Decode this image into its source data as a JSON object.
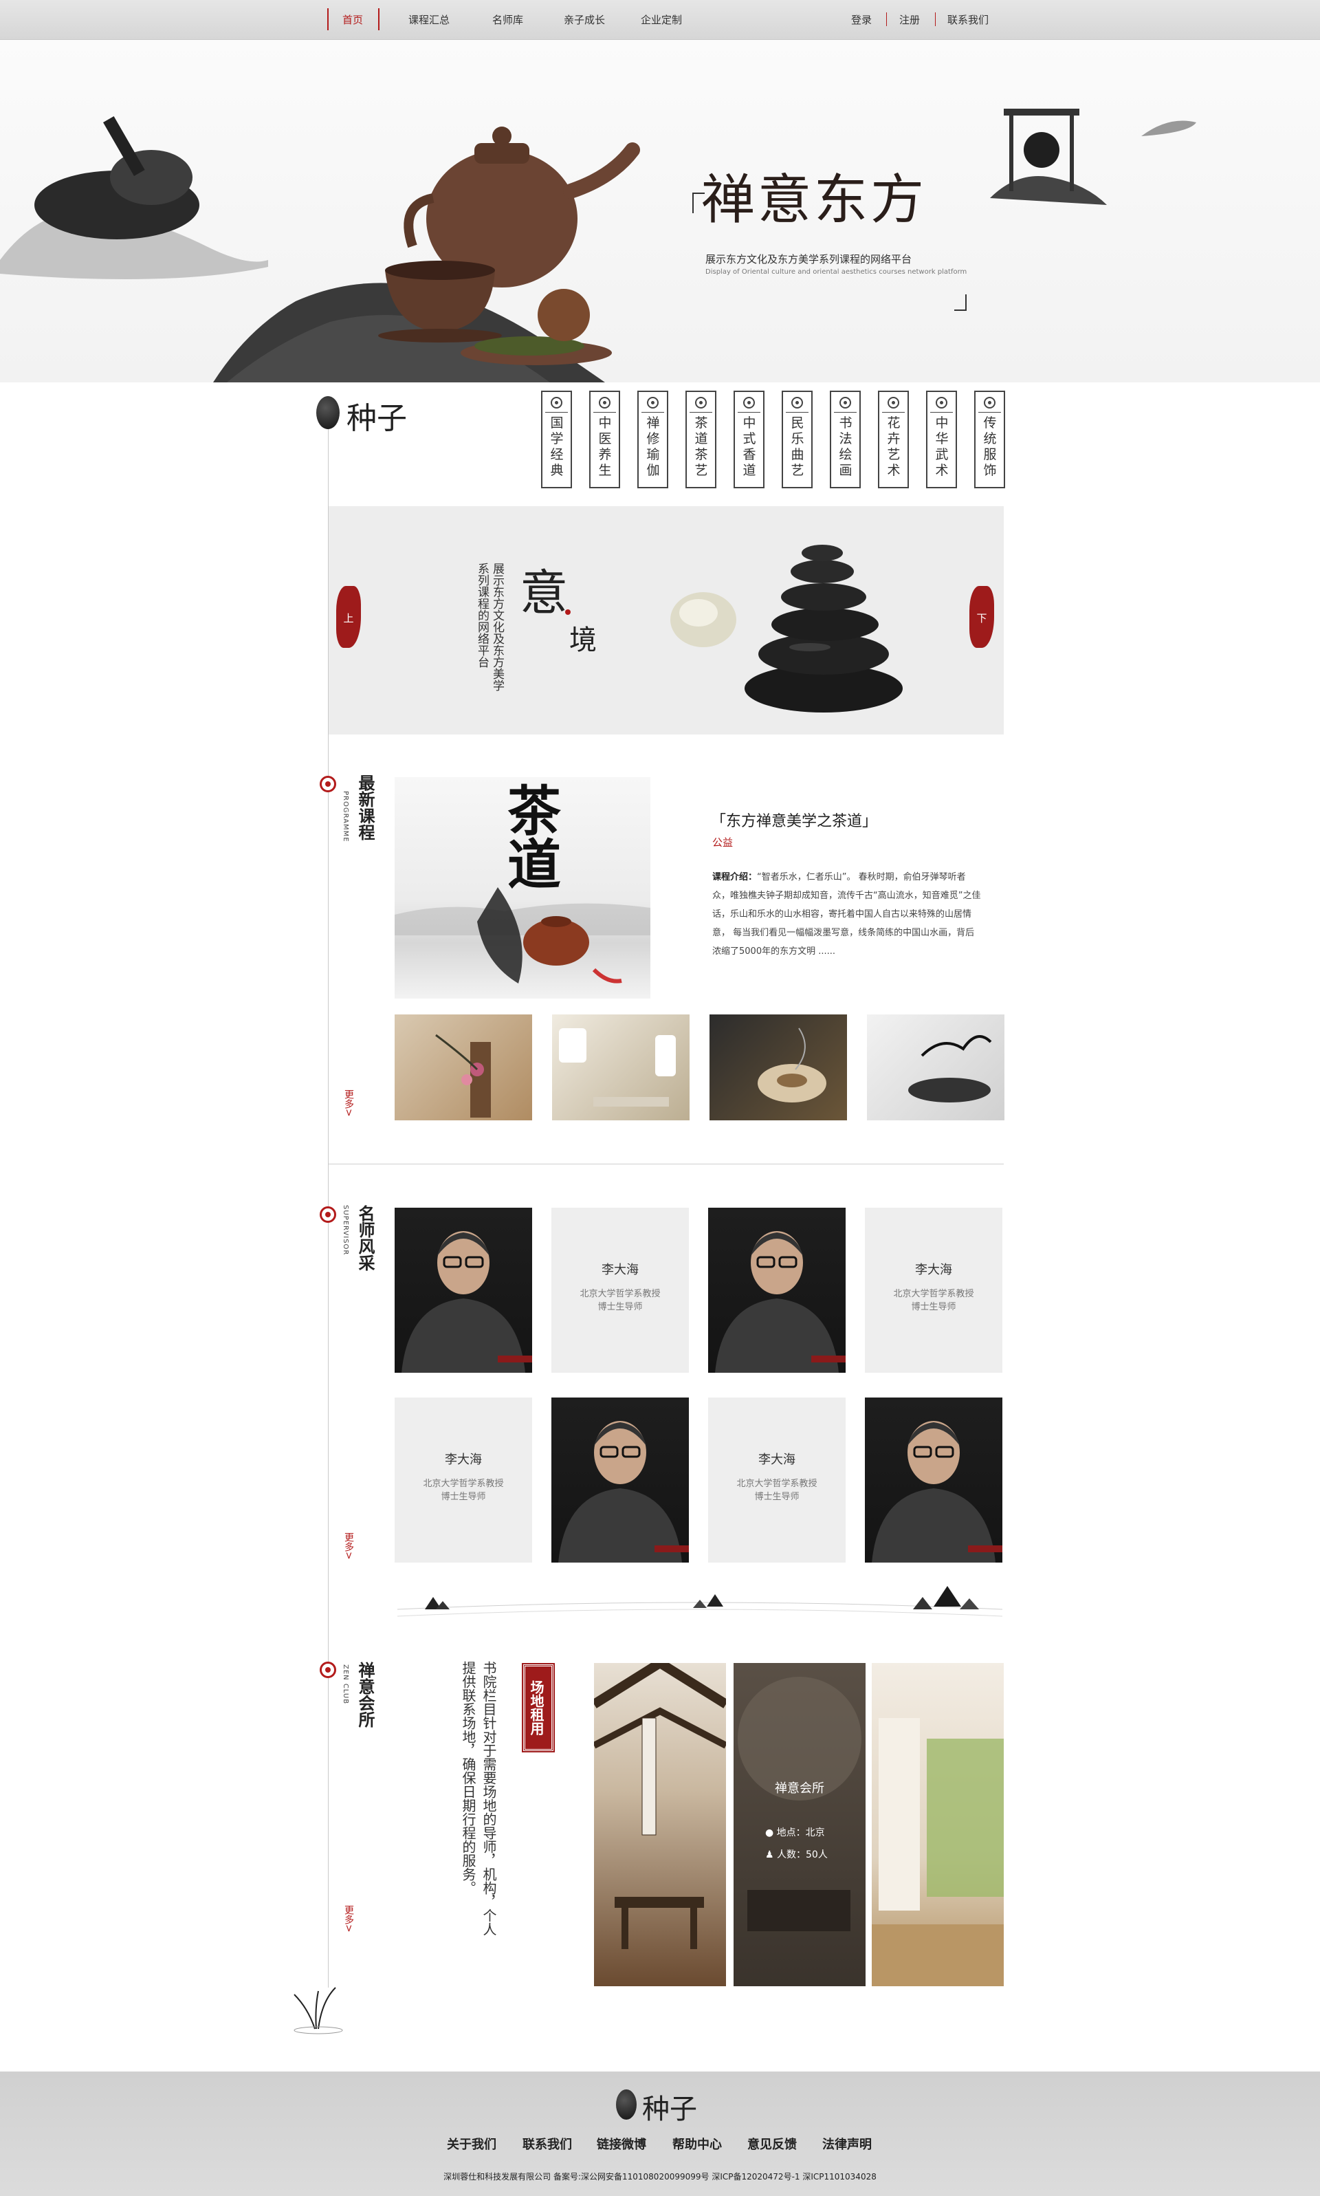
{
  "nav": {
    "items": [
      "首页",
      "课程汇总",
      "名师库",
      "亲子成长",
      "企业定制"
    ],
    "right": [
      "登录",
      "注册",
      "联系我们"
    ]
  },
  "banner": {
    "title": "禅意东方",
    "subtitle": "展示东方文化及东方美学系列课程的网络平台",
    "subtitle_en": "Display of Oriental culture and oriental aesthetics courses network platform"
  },
  "brand": {
    "name": "种子"
  },
  "categories": [
    "国学经典",
    "中医养生",
    "禅修瑜伽",
    "茶道茶艺",
    "中式香道",
    "民乐曲艺",
    "书法绘画",
    "花卉艺术",
    "中华武术",
    "传统服饰"
  ],
  "yijing": {
    "text": "展示东方文化及东方美学系列课程的网络平台",
    "yi": "意",
    "jing": "境",
    "prev": "上",
    "next": "下"
  },
  "courses": {
    "title": "最新课程",
    "title_en": "PROGRAMME",
    "featured_title": "东方禅意美学之茶道",
    "featured_tag": "公益",
    "desc_label": "课程介绍：",
    "desc": "“智者乐水，仁者乐山”。 春秋时期，俞伯牙弹琴听者众，唯独樵夫钟子期却成知音，流传千古“高山流水，知音难觅”之佳话，乐山和乐水的山水相容，寄托着中国人自古以来特殊的山居情意， 每当我们看见一幅幅泼墨写意，线条简练的中国山水画，背后浓缩了5000年的东方文明 ......",
    "image_text": "茶道",
    "more": "更多>"
  },
  "teachers": {
    "title": "名师风采",
    "title_en": "SUPERVISOR",
    "name": "李大海",
    "line1": "北京大学哲学系教授",
    "line2": "博士生导师",
    "more": "更多>"
  },
  "club": {
    "title": "禅意会所",
    "title_en": "ZEN CLUB",
    "text": "书院栏目针对于需要场地的导师，机构，个人提供联系场地，确保日期行程的服务。",
    "badge": "场地租用",
    "center_name": "禅意会所",
    "location": "地点：北京",
    "people": "人数：50人",
    "more": "更多>"
  },
  "footer": {
    "links": [
      "关于我们",
      "联系我们",
      "链接微博",
      "帮助中心",
      "意见反馈",
      "法律声明"
    ],
    "copyright": "深圳蓉仕和科技发展有限公司     备案号:深公网安备110108020099099号  深ICP备12020472号-1  深ICP1101034028"
  }
}
